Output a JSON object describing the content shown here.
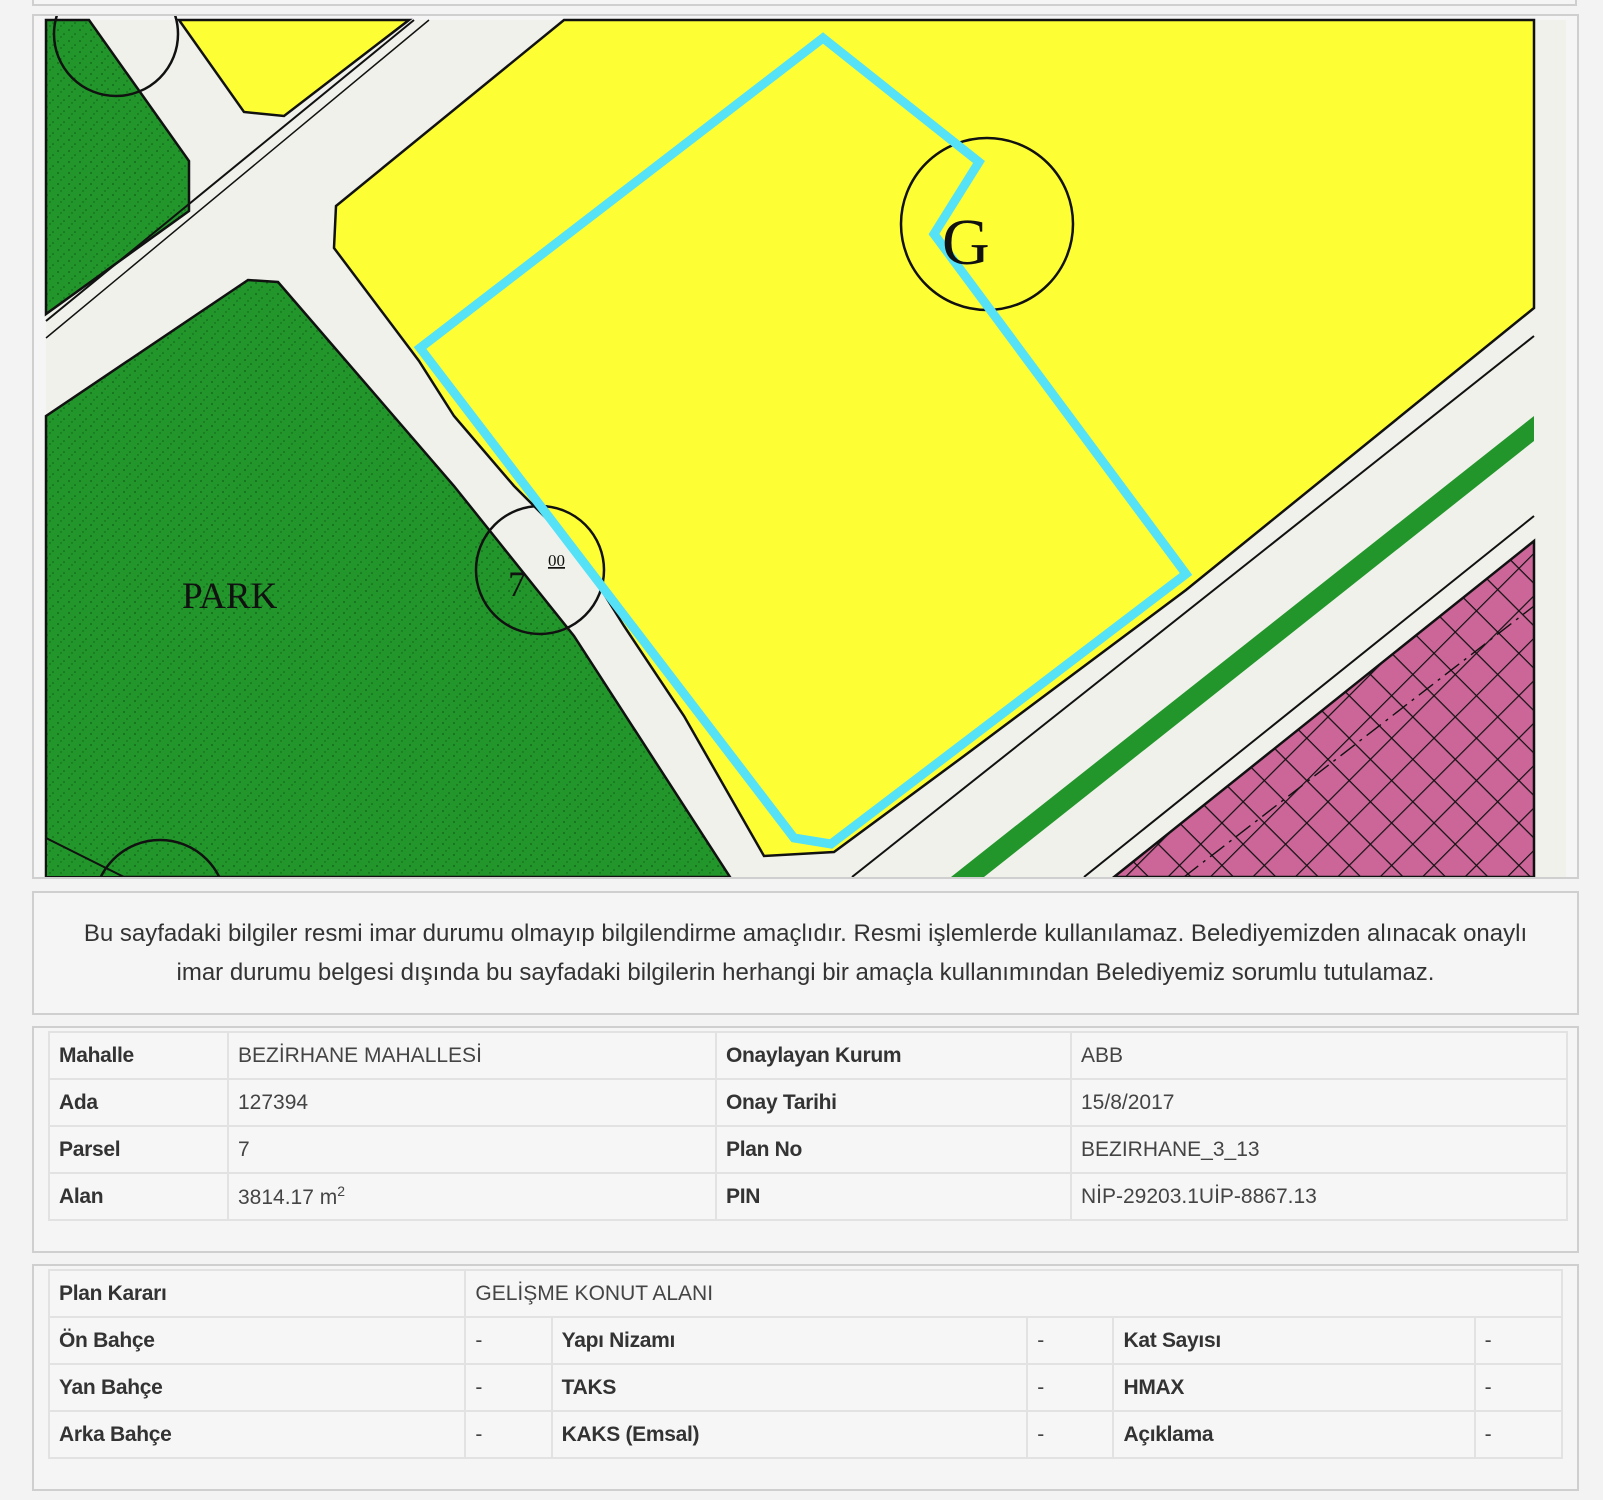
{
  "map": {
    "park_label": "PARK",
    "zone_label": "G",
    "parcel_number": "7",
    "parcel_sub": "00",
    "colors": {
      "road": "#f1f1ec",
      "residential": "#fefe35",
      "park": "#22962a",
      "park_dots": "#0f5e16",
      "commercial": "#cc6598",
      "parcel_outline": "#55e1f6",
      "line": "#111111"
    }
  },
  "notice": {
    "text": "Bu sayfadaki bilgiler resmi imar durumu olmayıp bilgilendirme amaçlıdır. Resmi işlemlerde kullanılamaz. Belediyemizden alınacak onaylı imar durumu belgesi dışında bu sayfadaki bilgilerin herhangi bir amaçla kullanımından Belediyemiz sorumlu tutulamaz."
  },
  "info": {
    "mahalle_label": "Mahalle",
    "mahalle_value": "BEZİRHANE MAHALLESİ",
    "ada_label": "Ada",
    "ada_value": "127394",
    "parsel_label": "Parsel",
    "parsel_value": "7",
    "alan_label": "Alan",
    "alan_value": "3814.17 m",
    "alan_unit_exp": "2",
    "onaylayan_label": "Onaylayan Kurum",
    "onaylayan_value": "ABB",
    "onay_tarihi_label": "Onay Tarihi",
    "onay_tarihi_value": "15/8/2017",
    "plan_no_label": "Plan No",
    "plan_no_value": "BEZIRHANE_3_13",
    "pin_label": "PIN",
    "pin_value": "NİP-29203.1UİP-8867.13"
  },
  "plan": {
    "plan_karari_label": "Plan Kararı",
    "plan_karari_value": "GELİŞME KONUT ALANI",
    "on_bahce_label": "Ön Bahçe",
    "on_bahce_value": "-",
    "yan_bahce_label": "Yan Bahçe",
    "yan_bahce_value": "-",
    "arka_bahce_label": "Arka Bahçe",
    "arka_bahce_value": "-",
    "yapi_nizami_label": "Yapı Nizamı",
    "yapi_nizami_value": "-",
    "taks_label": "TAKS",
    "taks_value": "-",
    "kaks_label": "KAKS (Emsal)",
    "kaks_value": "-",
    "kat_sayisi_label": "Kat Sayısı",
    "kat_sayisi_value": "-",
    "hmax_label": "HMAX",
    "hmax_value": "-",
    "aciklama_label": "Açıklama",
    "aciklama_value": "-"
  }
}
